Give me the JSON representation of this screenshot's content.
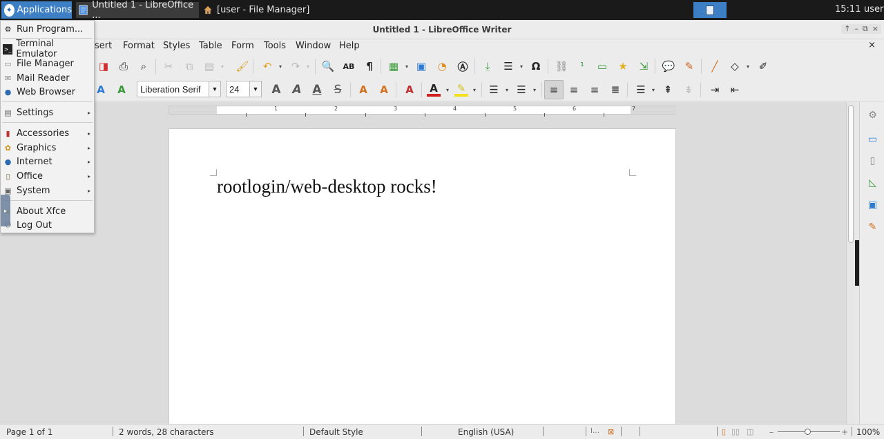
{
  "panel": {
    "applications_label": "Applications",
    "tasks": [
      {
        "label": "Untitled 1 - LibreOffice ...",
        "icon": "writer-doc-icon"
      },
      {
        "label": "[user - File Manager]",
        "icon": "home-folder-icon"
      }
    ],
    "clock": "15:11",
    "user": "user"
  },
  "window": {
    "title": "Untitled 1 - LibreOffice Writer",
    "controls": [
      "↑",
      "–",
      "⧉",
      "×"
    ]
  },
  "menubar": {
    "items": [
      "sert",
      "Format",
      "Styles",
      "Table",
      "Form",
      "Tools",
      "Window",
      "Help"
    ],
    "close_doc": "×"
  },
  "formatting": {
    "font_name": "Liberation Serif",
    "font_size": "24"
  },
  "document": {
    "text": "rootlogin/web-desktop rocks!"
  },
  "ruler": {
    "numbers": [
      "1",
      "2",
      "3",
      "4",
      "5",
      "6",
      "7"
    ]
  },
  "statusbar": {
    "page": "Page 1 of 1",
    "words": "2 words, 28 characters",
    "style": "Default Style",
    "language": "English (USA)",
    "zoom": "100%",
    "zoom_minus": "–",
    "zoom_plus": "+"
  },
  "app_menu": {
    "items": [
      {
        "label": "Run Program...",
        "icon": "run-icon",
        "submenu": false
      },
      {
        "label": "Terminal Emulator",
        "icon": "terminal-icon",
        "submenu": false
      },
      {
        "label": "File Manager",
        "icon": "file-manager-icon",
        "submenu": false
      },
      {
        "label": "Mail Reader",
        "icon": "mail-icon",
        "submenu": false
      },
      {
        "label": "Web Browser",
        "icon": "globe-icon",
        "submenu": false
      },
      {
        "label": "Settings",
        "icon": "settings-icon",
        "submenu": true
      },
      {
        "label": "Accessories",
        "icon": "accessories-icon",
        "submenu": true
      },
      {
        "label": "Graphics",
        "icon": "graphics-icon",
        "submenu": true
      },
      {
        "label": "Internet",
        "icon": "internet-icon",
        "submenu": true
      },
      {
        "label": "Office",
        "icon": "office-icon",
        "submenu": true
      },
      {
        "label": "System",
        "icon": "system-icon",
        "submenu": true
      },
      {
        "label": "About Xfce",
        "icon": "star-icon",
        "submenu": false
      },
      {
        "label": "Log Out",
        "icon": "power-icon",
        "submenu": false
      }
    ],
    "submenu_arrow": "▸"
  },
  "colors": {
    "accent": "#3d7fc4",
    "panel_bg": "#1a1a1a",
    "chrome_bg": "#ececec"
  }
}
